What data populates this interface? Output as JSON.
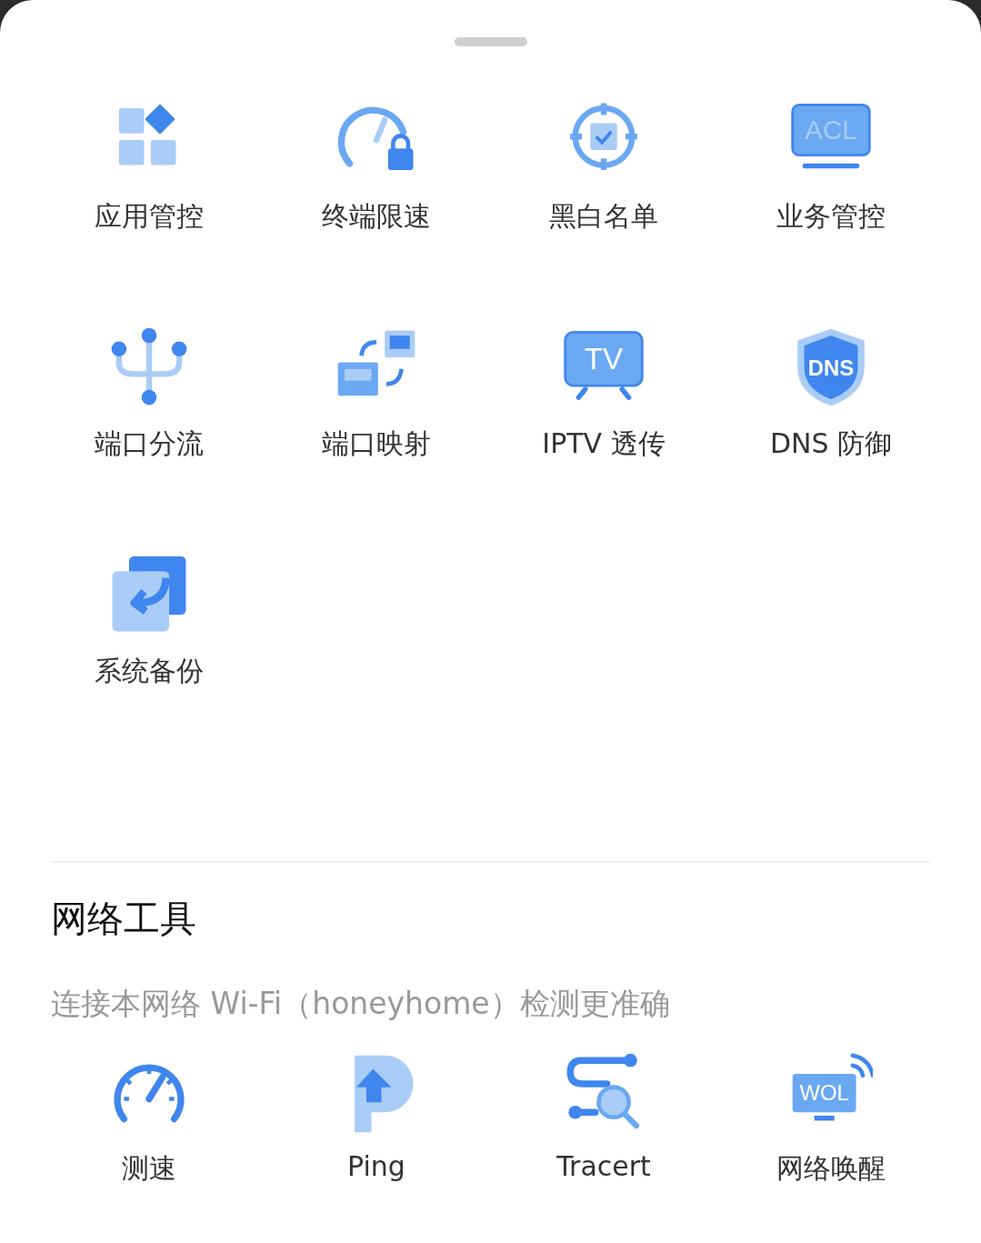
{
  "features": [
    {
      "label": "应用管控"
    },
    {
      "label": "终端限速"
    },
    {
      "label": "黑白名单"
    },
    {
      "label": "业务管控",
      "icon_text": "ACL"
    },
    {
      "label": "端口分流"
    },
    {
      "label": "端口映射"
    },
    {
      "label": "IPTV 透传",
      "icon_text": "TV"
    },
    {
      "label": "DNS 防御",
      "icon_text": "DNS"
    },
    {
      "label": "系统备份"
    }
  ],
  "network_tools": {
    "title": "网络工具",
    "hint": "连接本网络 Wi-Fi（honeyhome）检测更准确",
    "tools": [
      {
        "label": "测速"
      },
      {
        "label": "Ping"
      },
      {
        "label": "Tracert"
      },
      {
        "label": "网络唤醒",
        "icon_text": "WOL"
      }
    ]
  }
}
